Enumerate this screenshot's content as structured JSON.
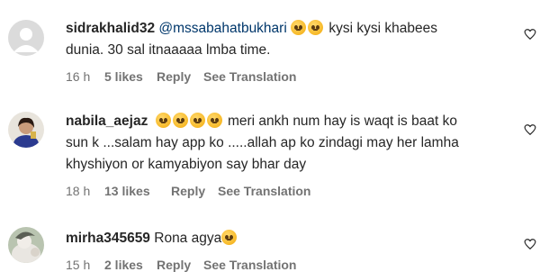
{
  "comments": [
    {
      "username": "sidrakhalid32",
      "mention": "@mssabahatbukhari",
      "text_after_emojis": "kysi kysi khabees",
      "text_line2": "dunia. 30 sal itnaaaaa lmba time.",
      "time": "16 h",
      "likes": "5 likes",
      "reply": "Reply",
      "translation": "See Translation",
      "avatar": "default-avatar-icon"
    },
    {
      "username": "nabila_aejaz",
      "text_after_emojis": "meri ankh num hay is waqt is baat ko",
      "text_line2": "sun k ...salam hay app ko .....allah ap ko zindagi may her lamha",
      "text_line3": "khyshiyon or kamyabiyon say bhar day",
      "time": "18 h",
      "likes": "13 likes",
      "reply": "Reply",
      "translation": "See Translation",
      "avatar": "profile-photo"
    },
    {
      "username": "mirha345659",
      "text": "Rona agya",
      "time": "15 h",
      "likes": "2 likes",
      "reply": "Reply",
      "translation": "See Translation",
      "avatar": "profile-photo"
    }
  ],
  "colors": {
    "text": "#262626",
    "meta": "#737373",
    "mention": "#00376b",
    "avatar_default": "#c7c7c7"
  }
}
